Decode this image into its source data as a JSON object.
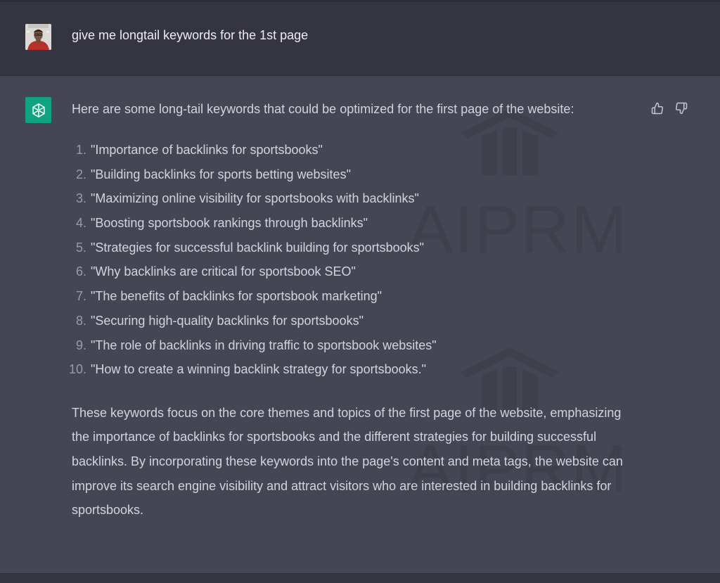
{
  "user_message": {
    "text": "give me longtail keywords for the 1st page"
  },
  "assistant_message": {
    "intro": "Here are some long-tail keywords that could be optimized for the first page of the website:",
    "keywords": [
      {
        "num": "1.",
        "text": "\"Importance of backlinks for sportsbooks\""
      },
      {
        "num": "2.",
        "text": "\"Building backlinks for sports betting websites\""
      },
      {
        "num": "3.",
        "text": "\"Maximizing online visibility for sportsbooks with backlinks\""
      },
      {
        "num": "4.",
        "text": "\"Boosting sportsbook rankings through backlinks\""
      },
      {
        "num": "5.",
        "text": "\"Strategies for successful backlink building for sportsbooks\""
      },
      {
        "num": "6.",
        "text": "\"Why backlinks are critical for sportsbook SEO\""
      },
      {
        "num": "7.",
        "text": "\"The benefits of backlinks for sportsbook marketing\""
      },
      {
        "num": "8.",
        "text": "\"Securing high-quality backlinks for sportsbooks\""
      },
      {
        "num": "9.",
        "text": "\"The role of backlinks in driving traffic to sportsbook websites\""
      },
      {
        "num": "10.",
        "text": "\"How to create a winning backlink strategy for sportsbooks.\""
      }
    ],
    "outro": "These keywords focus on the core themes and topics of the first page of the website, emphasizing the importance of backlinks for sportsbooks and the different strategies for building successful backlinks. By incorporating these keywords into the page's content and meta tags, the website can improve its search engine visibility and attract visitors who are interested in building backlinks for sportsbooks."
  },
  "watermark": {
    "text": "AIPRM"
  },
  "icons": {
    "user_avatar": "user-avatar-photo",
    "assistant_avatar": "openai-logo-icon",
    "thumbs_up": "thumbs-up-icon",
    "thumbs_down": "thumbs-down-icon"
  },
  "colors": {
    "user_row_bg": "#343541",
    "assistant_row_bg": "#444654",
    "assistant_avatar_bg": "#10a37f",
    "text": "#d1d5db",
    "list_number": "#9a9ba6",
    "watermark": "#3e404c"
  }
}
